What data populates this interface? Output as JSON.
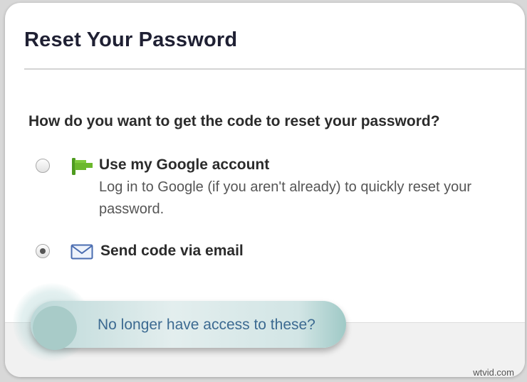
{
  "dialog": {
    "title": "Reset Your Password",
    "question": "How do you want to get the code to reset your password?"
  },
  "options": [
    {
      "label": "Use my Google account",
      "description": "Log in to Google (if you aren't already) to quickly reset your password.",
      "icon": "google-flag-icon",
      "selected": false
    },
    {
      "label": "Send code via email",
      "icon": "envelope-icon",
      "selected": true
    }
  ],
  "footer": {
    "link_text": "No longer have access to these?"
  },
  "watermark": "wtvid.com",
  "colors": {
    "link": "#3c6a91",
    "google_icon": "#6bb82c",
    "envelope_icon": "#4a6cb0",
    "highlight": "#bcd8d8"
  }
}
